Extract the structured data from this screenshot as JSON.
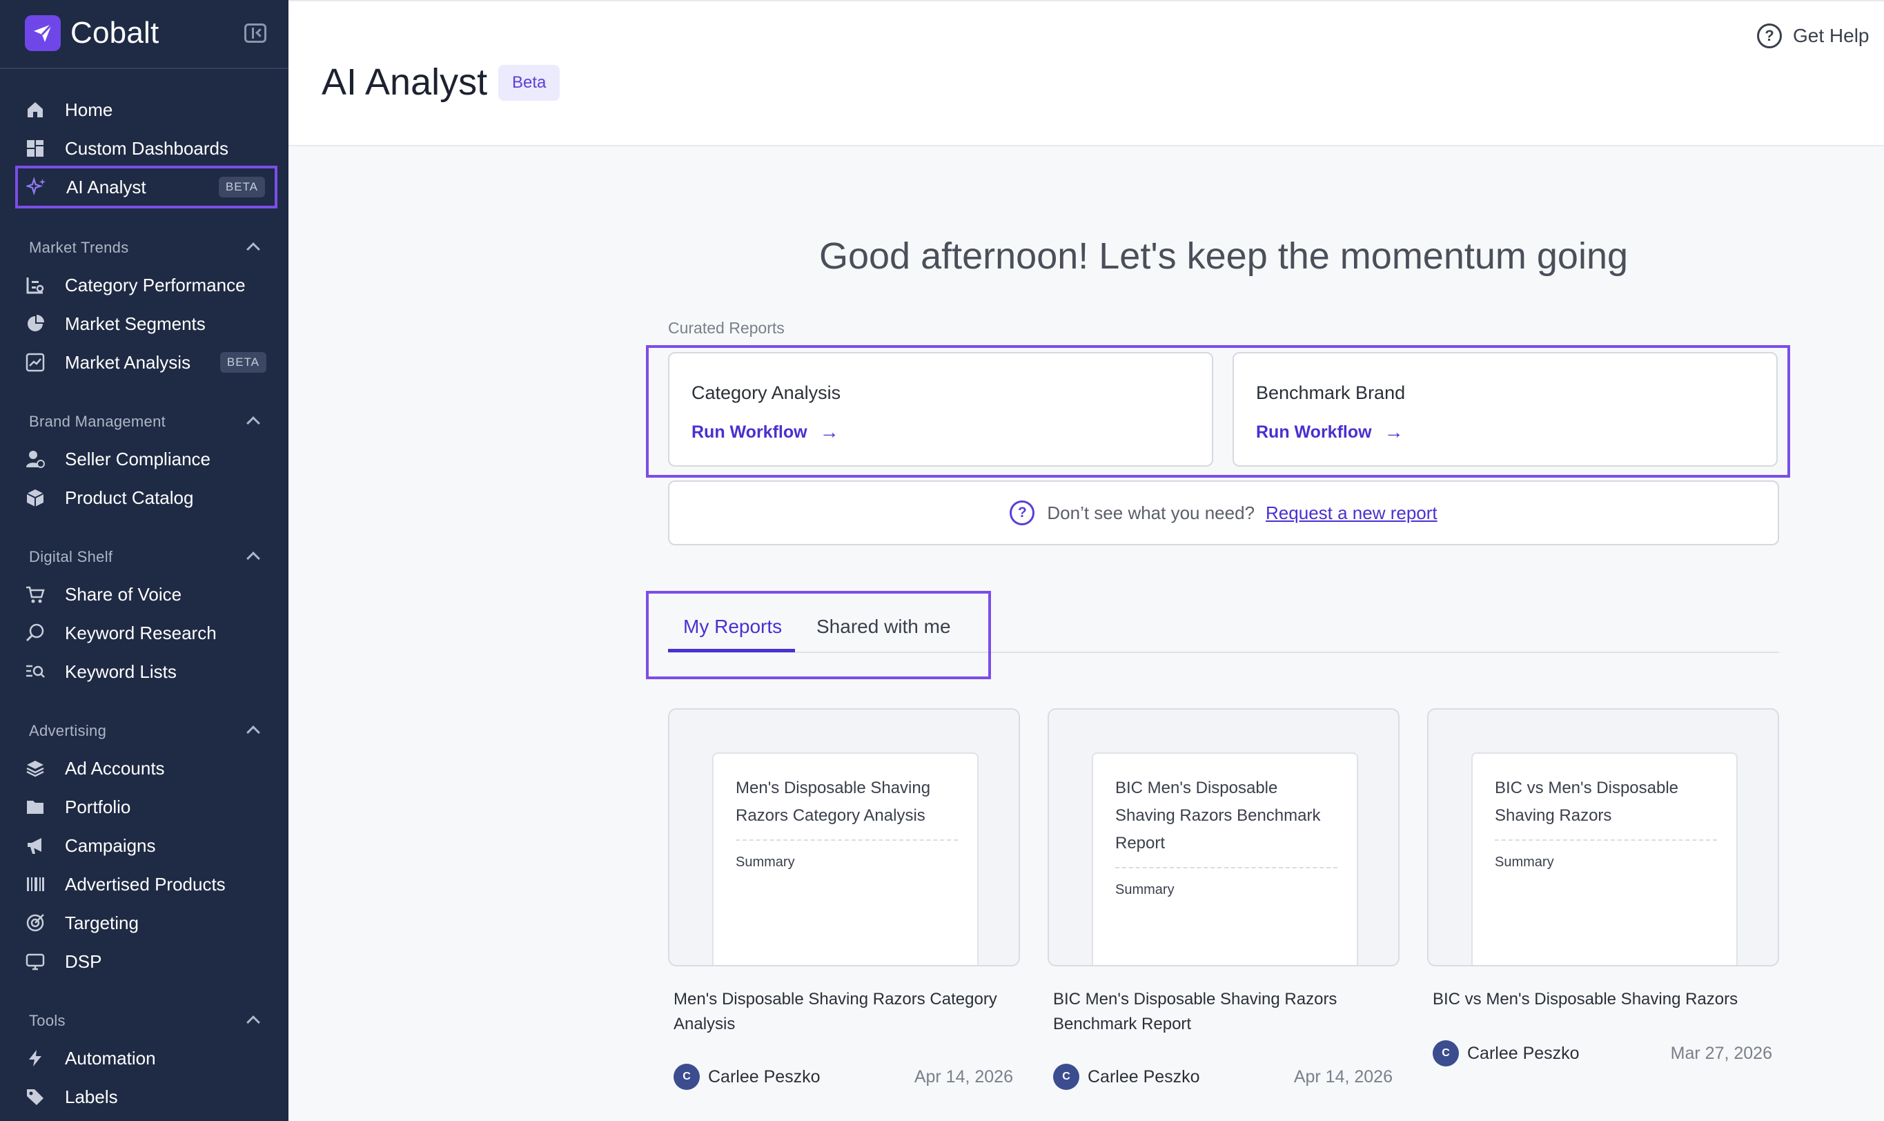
{
  "brand": {
    "name": "Cobalt"
  },
  "nav": {
    "top": [
      {
        "label": "Home",
        "icon": "home-icon"
      },
      {
        "label": "Custom Dashboards",
        "icon": "dashboard-icon"
      },
      {
        "label": "AI Analyst",
        "icon": "sparkle-icon",
        "badge": "BETA",
        "active": true
      }
    ],
    "sections": [
      {
        "label": "Market Trends",
        "items": [
          {
            "label": "Category Performance",
            "icon": "category-icon"
          },
          {
            "label": "Market Segments",
            "icon": "pie-icon"
          },
          {
            "label": "Market Analysis",
            "icon": "trend-icon",
            "badge": "BETA"
          }
        ]
      },
      {
        "label": "Brand Management",
        "items": [
          {
            "label": "Seller Compliance",
            "icon": "seller-icon"
          },
          {
            "label": "Product Catalog",
            "icon": "box-icon"
          }
        ]
      },
      {
        "label": "Digital Shelf",
        "items": [
          {
            "label": "Share of Voice",
            "icon": "cart-icon"
          },
          {
            "label": "Keyword Research",
            "icon": "search-icon"
          },
          {
            "label": "Keyword Lists",
            "icon": "list-search-icon"
          }
        ]
      },
      {
        "label": "Advertising",
        "items": [
          {
            "label": "Ad Accounts",
            "icon": "layers-icon"
          },
          {
            "label": "Portfolio",
            "icon": "folder-icon"
          },
          {
            "label": "Campaigns",
            "icon": "megaphone-icon"
          },
          {
            "label": "Advertised Products",
            "icon": "barcode-icon"
          },
          {
            "label": "Targeting",
            "icon": "target-icon"
          },
          {
            "label": "DSP",
            "icon": "monitor-icon"
          }
        ]
      },
      {
        "label": "Tools",
        "items": [
          {
            "label": "Automation",
            "icon": "bolt-icon"
          },
          {
            "label": "Labels",
            "icon": "tag-icon"
          }
        ]
      }
    ]
  },
  "header": {
    "title": "AI Analyst",
    "badge": "Beta",
    "help": "Get Help"
  },
  "main": {
    "greeting": "Good afternoon! Let's keep the momentum going",
    "curated_label": "Curated Reports",
    "curated": [
      {
        "title": "Category Analysis",
        "action": "Run Workflow"
      },
      {
        "title": "Benchmark Brand",
        "action": "Run Workflow"
      }
    ],
    "request": {
      "text": "Don’t see what you need?",
      "link": "Request a new report"
    },
    "tabs": [
      {
        "label": "My Reports",
        "active": true
      },
      {
        "label": "Shared with me",
        "active": false
      }
    ],
    "reports": [
      {
        "doc_title": "Men's Disposable Shaving Razors Category Analysis",
        "doc_section": "Summary",
        "title": "Men's Disposable Shaving Razors Category Analysis",
        "author_initial": "C",
        "author": "Carlee Peszko",
        "date": "Apr 14, 2026"
      },
      {
        "doc_title": "BIC Men's Disposable Shaving Razors Benchmark Report",
        "doc_section": "Summary",
        "title": "BIC Men's Disposable Shaving Razors Benchmark Report",
        "author_initial": "C",
        "author": "Carlee Peszko",
        "date": "Apr 14, 2026"
      },
      {
        "doc_title": "BIC vs Men's Disposable Shaving Razors",
        "doc_section": "Summary",
        "title": "BIC vs Men's Disposable Shaving Razors",
        "author_initial": "C",
        "author": "Carlee Peszko",
        "date": "Mar 27, 2026"
      }
    ]
  },
  "colors": {
    "sidebar": "#1f2a44",
    "accent": "#4b2fd1",
    "highlight": "#7b4ee8"
  }
}
